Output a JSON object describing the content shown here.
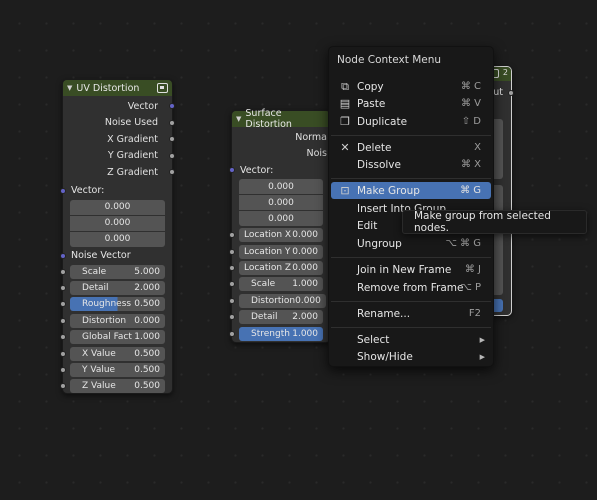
{
  "uv_node": {
    "title": "UV Distortion",
    "outputs": [
      "Vector",
      "Noise Used",
      "X Gradient",
      "Y Gradient",
      "Z Gradient"
    ],
    "vector_label": "Vector:",
    "vector_values": [
      "0.000",
      "0.000",
      "0.000"
    ],
    "noise_vector_label": "Noise Vector",
    "props": [
      {
        "label": "Scale",
        "value": "5.000"
      },
      {
        "label": "Detail",
        "value": "2.000"
      },
      {
        "label": "Roughness",
        "value": "0.500"
      },
      {
        "label": "Distortion",
        "value": "0.000"
      },
      {
        "label": "Global Fact",
        "value": "1.000"
      },
      {
        "label": "X Value",
        "value": "0.500"
      },
      {
        "label": "Y Value",
        "value": "0.500"
      },
      {
        "label": "Z Value",
        "value": "0.500"
      }
    ]
  },
  "surface_node": {
    "title": "Surface Distortion",
    "outputs": [
      "Norma",
      "Nois"
    ],
    "vector_label": "Vector:",
    "vector_values": [
      "0.000",
      "0.000",
      "0.000"
    ],
    "props": [
      {
        "label": "Location X",
        "value": "0.000"
      },
      {
        "label": "Location Y",
        "value": "0.000"
      },
      {
        "label": "Location Z",
        "value": "0.000"
      },
      {
        "label": "Scale",
        "value": "1.000"
      },
      {
        "label": "Distortion",
        "value": "0.000"
      },
      {
        "label": "Detail",
        "value": "2.000"
      },
      {
        "label": "Strength",
        "value": "1.000"
      }
    ]
  },
  "third_node": {
    "header_fragment": "2",
    "output_fragment": "ut"
  },
  "menu": {
    "title": "Node Context Menu",
    "items": {
      "copy": {
        "label": "Copy",
        "shortcut": "⌘ C"
      },
      "paste": {
        "label": "Paste",
        "shortcut": "⌘ V"
      },
      "duplicate": {
        "label": "Duplicate",
        "shortcut": "⇧ D"
      },
      "delete": {
        "label": "Delete",
        "shortcut": "X"
      },
      "dissolve": {
        "label": "Dissolve",
        "shortcut": "⌘ X"
      },
      "make_group": {
        "label": "Make Group",
        "shortcut": "⌘ G"
      },
      "insert_into_group": {
        "label": "Insert Into Group",
        "shortcut": ""
      },
      "edit": {
        "label": "Edit",
        "shortcut": ""
      },
      "ungroup": {
        "label": "Ungroup",
        "shortcut": "⌥ ⌘ G"
      },
      "join_new_frame": {
        "label": "Join in New Frame",
        "shortcut": "⌘ J"
      },
      "remove_from_frame": {
        "label": "Remove from Frame",
        "shortcut": "⌥ P"
      },
      "rename": {
        "label": "Rename...",
        "shortcut": "F2"
      },
      "select": {
        "label": "Select"
      },
      "show_hide": {
        "label": "Show/Hide"
      }
    }
  },
  "tooltip": "Make group from selected nodes.",
  "colors": {
    "node_header": "#394d24",
    "highlight": "#4772b3",
    "socket_vector": "#6363c7",
    "socket_value": "#a1a1a1"
  }
}
